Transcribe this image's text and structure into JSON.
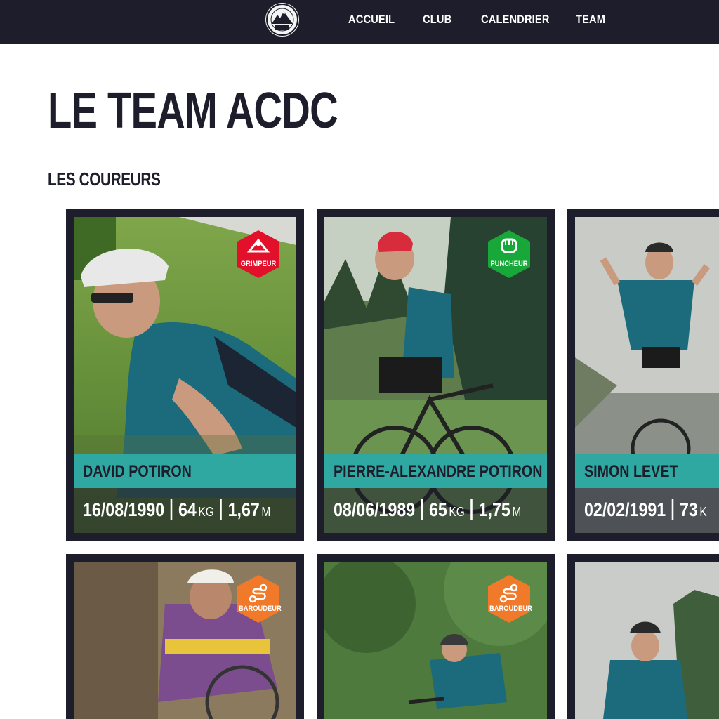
{
  "nav": {
    "logo_text": "1909",
    "items": [
      {
        "label": "ACCUEIL"
      },
      {
        "label": "CLUB"
      },
      {
        "label": "CALENDRIER"
      },
      {
        "label": "TEAM"
      }
    ]
  },
  "page_title": "LE TEAM ACDC",
  "section_title": "LES COUREURS",
  "colors": {
    "dark": "#1e1d2b",
    "teal": "#2fa8a2",
    "grimpeur": "#e2102b",
    "puncheur": "#18a83a",
    "baroudeur": "#f07a29"
  },
  "riders": [
    {
      "name": "DAVID POTIRON",
      "birth": "16/08/1990",
      "weight": "64",
      "weight_unit": "KG",
      "height": "1,67",
      "height_unit": "M",
      "badge": {
        "label": "GRIMPEUR",
        "icon": "mountain-icon"
      }
    },
    {
      "name": "PIERRE-ALEXANDRE POTIRON",
      "birth": "08/06/1989",
      "weight": "65",
      "weight_unit": "KG",
      "height": "1,75",
      "height_unit": "M",
      "badge": {
        "label": "PUNCHEUR",
        "icon": "fist-icon"
      }
    },
    {
      "name": "SIMON LEVET",
      "birth": "02/02/1991",
      "weight": "73",
      "weight_unit": "K",
      "height": "",
      "height_unit": "",
      "badge": null
    },
    {
      "name": "",
      "badge": {
        "label": "BAROUDEUR",
        "icon": "route-icon"
      }
    },
    {
      "name": "",
      "badge": {
        "label": "BAROUDEUR",
        "icon": "route-icon"
      }
    },
    {
      "name": "",
      "badge": null
    }
  ]
}
